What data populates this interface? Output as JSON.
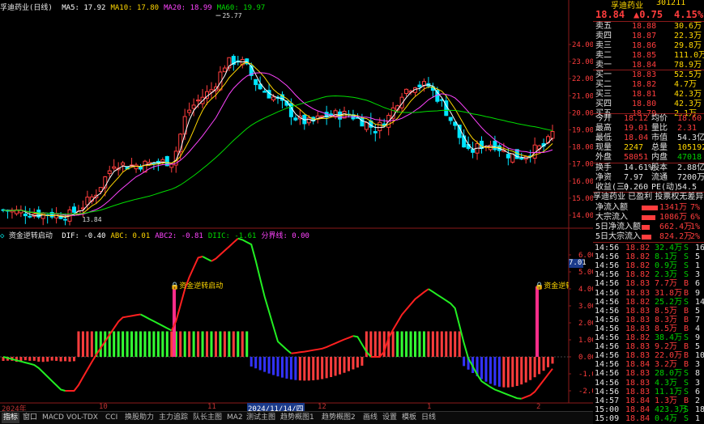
{
  "main_chart": {
    "title": "孚迪药业(日线)",
    "ma_labels": [
      {
        "text": "MA5: 17.92",
        "color": "#ffffff"
      },
      {
        "text": "MA10: 17.80",
        "color": "#ffd700"
      },
      {
        "text": "MA20: 18.99",
        "color": "#ff44ff"
      },
      {
        "text": "MA60: 19.97",
        "color": "#00dd00"
      }
    ],
    "price_ticks": [
      "24.00",
      "23.00",
      "22.00",
      "21.00",
      "20.00",
      "19.00",
      "18.00",
      "17.00",
      "16.00",
      "15.00",
      "14.00"
    ],
    "high_marker": "25.77",
    "low_marker": "13.84"
  },
  "indicator": {
    "title": "资金逆转启动",
    "values": [
      {
        "text": "DIF: -0.40",
        "color": "#ffffff"
      },
      {
        "text": "ABC: 0.01",
        "color": "#ffd700"
      },
      {
        "text": "ABC2: -0.81",
        "color": "#ff44ff"
      },
      {
        "text": "DIIC: -1.61",
        "color": "#00dd00"
      },
      {
        "text": "分界线: 0.00",
        "color": "#ff44ff"
      }
    ],
    "ticks": [
      "6.00",
      "5.00",
      "4.00",
      "3.00",
      "2.00",
      "1.00",
      "0.00",
      "-1.00",
      "-2.00"
    ],
    "current_value": "7.01",
    "signal_label": "资金逆转启动"
  },
  "time_axis": {
    "labels": [
      "2024年",
      "10",
      "11",
      "2024/11/14/四",
      "12",
      "1",
      "2"
    ]
  },
  "bottom_tabs": [
    "指标",
    "窗口",
    "MACD",
    "VOL-TDX",
    "CCI",
    "换股助力",
    "主力追踪",
    "队长主图",
    "MA2",
    "测试主图",
    "趋势概图1",
    "趋势概图2",
    "画线",
    "设置",
    "模板",
    "日线"
  ],
  "quote": {
    "name": "孚迪药业",
    "code": "301211",
    "price": "18.84",
    "change": "▲0.75",
    "pct": "4.15%",
    "asks": [
      {
        "label": "卖五",
        "price": "18.88",
        "vol": "30.6万"
      },
      {
        "label": "卖四",
        "price": "18.87",
        "vol": "22.3万"
      },
      {
        "label": "卖三",
        "price": "18.86",
        "vol": "29.8万"
      },
      {
        "label": "卖二",
        "price": "18.85",
        "vol": "111.0万"
      },
      {
        "label": "卖一",
        "price": "18.84",
        "vol": "78.9万"
      }
    ],
    "bids": [
      {
        "label": "买一",
        "price": "18.83",
        "vol": "52.5万"
      },
      {
        "label": "买二",
        "price": "18.82",
        "vol": "4.7万"
      },
      {
        "label": "买三",
        "price": "18.81",
        "vol": "42.3万"
      },
      {
        "label": "买四",
        "price": "18.80",
        "vol": "42.3万"
      },
      {
        "label": "买五",
        "price": "18.79",
        "vol": "2.1万"
      }
    ],
    "stats": [
      {
        "l1": "今开",
        "v1": "18.12",
        "c1": "#ff3d3d",
        "l2": "均价",
        "v2": "18.60",
        "c2": "#ff3d3d"
      },
      {
        "l1": "最高",
        "v1": "19.01",
        "c1": "#ff3d3d",
        "l2": "量比",
        "v2": "2.31",
        "c2": "#ff3d3d"
      },
      {
        "l1": "最低",
        "v1": "18.04",
        "c1": "#ff3d3d",
        "l2": "市值",
        "v2": "54.3亿",
        "c2": "#e6e6e6"
      },
      {
        "l1": "现量",
        "v1": "2247",
        "c1": "#ffd700",
        "l2": "总量",
        "v2": "105192",
        "c2": "#ffd700"
      },
      {
        "l1": "外盘",
        "v1": "58051",
        "c1": "#ff3d3d",
        "l2": "内盘",
        "v2": "47018",
        "c2": "#00d000"
      }
    ],
    "stats2": [
      {
        "l1": "换手",
        "v1": "14.61%",
        "l2": "股本",
        "v2": "2.88亿"
      },
      {
        "l1": "净资",
        "v1": "7.97",
        "l2": "流通",
        "v2": "7200万"
      },
      {
        "l1": "收益(三)",
        "v1": "0.260",
        "l2": "PE(动)",
        "v2": "54.5"
      }
    ],
    "info_line": "孚迪药业 已盈利 投票权无差异",
    "flows": [
      {
        "label": "净流入额",
        "value": "1341万",
        "pct": "7%",
        "bar": 0.9
      },
      {
        "label": "大宗流入",
        "value": "1086万",
        "pct": "6%",
        "bar": 0.75
      },
      {
        "label": "5日净流入额",
        "value": "662.4万",
        "pct": "1%",
        "bar": 0.45
      },
      {
        "label": "5日大宗流入",
        "value": "824.2万",
        "pct": "2%",
        "bar": 0.55
      }
    ],
    "ticks": [
      {
        "t": "14:56",
        "p": "18.82",
        "v": "32.4万",
        "d": "S",
        "n": "16"
      },
      {
        "t": "14:56",
        "p": "18.82",
        "v": "8.1万",
        "d": "S",
        "n": "5"
      },
      {
        "t": "14:56",
        "p": "18.82",
        "v": "0.9万",
        "d": "S",
        "n": "1"
      },
      {
        "t": "14:56",
        "p": "18.82",
        "v": "2.3万",
        "d": "S",
        "n": "3"
      },
      {
        "t": "14:56",
        "p": "18.83",
        "v": "7.7万",
        "d": "B",
        "n": "6"
      },
      {
        "t": "14:56",
        "p": "18.83",
        "v": "31.8万",
        "d": "B",
        "n": "9"
      },
      {
        "t": "14:56",
        "p": "18.82",
        "v": "25.2万",
        "d": "S",
        "n": "14"
      },
      {
        "t": "14:56",
        "p": "18.83",
        "v": "8.5万",
        "d": "B",
        "n": "5"
      },
      {
        "t": "14:56",
        "p": "18.83",
        "v": "8.3万",
        "d": "B",
        "n": "7"
      },
      {
        "t": "14:56",
        "p": "18.83",
        "v": "8.5万",
        "d": "B",
        "n": "4"
      },
      {
        "t": "14:56",
        "p": "18.82",
        "v": "38.4万",
        "d": "S",
        "n": "9"
      },
      {
        "t": "14:56",
        "p": "18.83",
        "v": "9.2万",
        "d": "B",
        "n": "5"
      },
      {
        "t": "14:56",
        "p": "18.83",
        "v": "22.0万",
        "d": "B",
        "n": "10"
      },
      {
        "t": "14:56",
        "p": "18.84",
        "v": "3.2万",
        "d": "B",
        "n": "3"
      },
      {
        "t": "14:56",
        "p": "18.83",
        "v": "28.0万",
        "d": "S",
        "n": "8"
      },
      {
        "t": "14:56",
        "p": "18.83",
        "v": "4.3万",
        "d": "S",
        "n": "3"
      },
      {
        "t": "14:56",
        "p": "18.83",
        "v": "11.1万",
        "d": "S",
        "n": "6"
      },
      {
        "t": "14:57",
        "p": "18.84",
        "v": "1.3万",
        "d": "B",
        "n": "2"
      },
      {
        "t": "15:00",
        "p": "18.84",
        "v": "423.3万",
        "d": "S",
        "n": "189"
      },
      {
        "t": "15:09",
        "p": "18.84",
        "v": "0.4万",
        "d": "S",
        "n": "1"
      }
    ]
  }
}
